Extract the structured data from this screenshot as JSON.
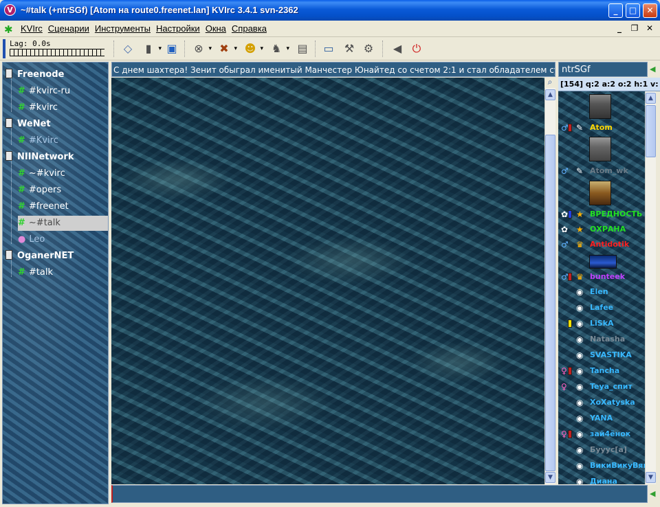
{
  "window": {
    "title": "~#talk (+ntrSGf) [Atom на route0.freenet.lan] KVIrc 3.4.1 svn-2362",
    "app_icon": "V",
    "buttons": {
      "minimize": "_",
      "maximize": "□",
      "close": "✕"
    }
  },
  "menubar": {
    "items": [
      "KVIrc",
      "Сценарии",
      "Инструменты",
      "Настройки",
      "Окна",
      "Справка"
    ],
    "mdi": {
      "minimize": "_",
      "restore": "❐",
      "close": "✕"
    }
  },
  "toolbar": {
    "lag_label": "Lag: 0.0s"
  },
  "tree": {
    "networks": [
      {
        "name": "Freenode",
        "channels": [
          "#kvirc-ru",
          "#kvirc"
        ]
      },
      {
        "name": "WeNet",
        "channels": [
          "#Kvirc"
        ]
      },
      {
        "name": "NIINetwork",
        "channels": [
          "~#kvirc",
          "#opers",
          "#freenet",
          "~#talk"
        ],
        "query": "Leo"
      },
      {
        "name": "OganerNET",
        "channels": [
          "#talk"
        ]
      }
    ]
  },
  "topic": {
    "text": "С днем шахтера! Зенит обыграл именитый Манчестер Юнайтед со счетом 2:1 и стал обладателем суп"
  },
  "userlist": {
    "header": "ntrSGf",
    "stats": "[154] q:2 a:2 o:2 h:1 v:",
    "users": [
      {
        "nick": "Atom",
        "color": "#ffd700"
      },
      {
        "nick": "Atom_wk",
        "color": "#6a7a86"
      },
      {
        "nick": "ВРЕДНОСТЬ",
        "color": "#22e022"
      },
      {
        "nick": "ОХРАНА",
        "color": "#22e022"
      },
      {
        "nick": "Antidotik",
        "color": "#ff2020"
      },
      {
        "nick": "bunteek",
        "color": "#c040ff"
      },
      {
        "nick": "Elen",
        "color": "#38b8ff"
      },
      {
        "nick": "Lafee",
        "color": "#38b8ff"
      },
      {
        "nick": "LiSkA",
        "color": "#38b8ff"
      },
      {
        "nick": "Natasha",
        "color": "#7a8a96"
      },
      {
        "nick": "SVASTIKA",
        "color": "#38b8ff"
      },
      {
        "nick": "Tancha",
        "color": "#38b8ff"
      },
      {
        "nick": "Teya_спит",
        "color": "#38b8ff"
      },
      {
        "nick": "XoXatyska",
        "color": "#38b8ff"
      },
      {
        "nick": "YANA",
        "color": "#38b8ff"
      },
      {
        "nick": "зай4ёнок",
        "color": "#38b8ff"
      },
      {
        "nick": "Буууc[a]",
        "color": "#7a8a96"
      },
      {
        "nick": "ВикиВикуВяк",
        "color": "#38b8ff"
      },
      {
        "nick": "Диана",
        "color": "#38b8ff"
      }
    ]
  }
}
